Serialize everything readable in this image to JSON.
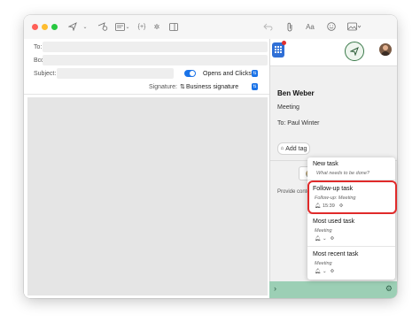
{
  "colors": {
    "accent": "#1a73e8",
    "footer": "#9ccfb5",
    "highlight": "#e02a2a"
  },
  "toolbar": {
    "icons": [
      "send-icon",
      "chevron-down-icon",
      "schedule-send-icon",
      "template-icon",
      "chevron-down-icon",
      "variables-icon",
      "ai-icon",
      "sidebar-icon",
      "undo-icon",
      "attachment-icon",
      "format-text-icon",
      "emoji-icon",
      "photo-icon"
    ],
    "format_label": "Aa",
    "variables_label": "{+}"
  },
  "compose": {
    "to_label": "To:",
    "bcc_label": "Bcc:",
    "subject_label": "Subject:",
    "tracking_label": "Opens and Clicks",
    "signature_label": "Signature:",
    "signature_value": "Business signature"
  },
  "panel": {
    "sender_name": "Ben Weber",
    "meeting": "Meeting",
    "to_line": "To: Paul Winter",
    "add_tag": "Add tag",
    "provide_text": "Provide conte"
  },
  "tasks": {
    "new_task": {
      "title": "New task",
      "placeholder": "What needs to be done?"
    },
    "follow_up": {
      "title": "Follow-up task",
      "subtitle": "Follow-up: Meeting",
      "time": "15:39"
    },
    "most_used": {
      "title": "Most used task",
      "subtitle": "Meeting"
    },
    "most_recent": {
      "title": "Most recent task",
      "subtitle": "Meeting"
    }
  }
}
